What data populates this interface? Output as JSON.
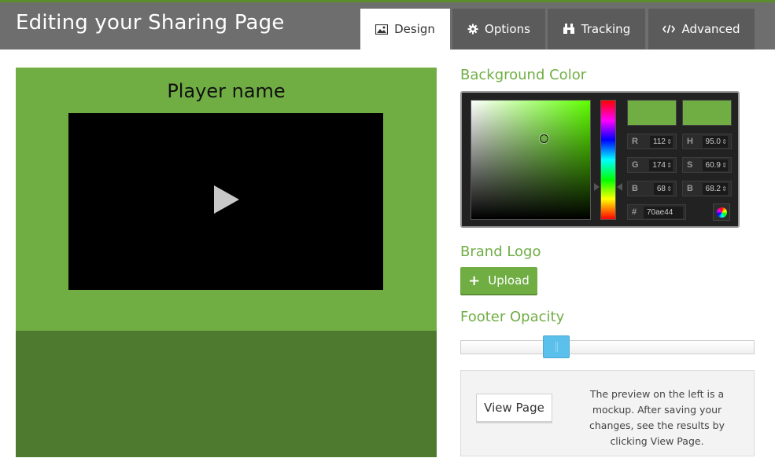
{
  "header": {
    "title": "Editing your Sharing Page",
    "tabs": [
      {
        "label": "Design",
        "icon": "image-icon",
        "active": true
      },
      {
        "label": "Options",
        "icon": "gear-icon",
        "active": false
      },
      {
        "label": "Tracking",
        "icon": "binoculars-icon",
        "active": false
      },
      {
        "label": "Advanced",
        "icon": "code-icon",
        "active": false
      }
    ]
  },
  "preview": {
    "player_name": "Player name",
    "background_color": "#70ae44",
    "footer_color": "#4e7a30"
  },
  "background_color": {
    "title": "Background Color",
    "r_label": "R",
    "r": "112",
    "g_label": "G",
    "g": "174",
    "b_label": "B",
    "b": "68",
    "h_label": "H",
    "h": "95.0",
    "s_label": "S",
    "s": "60.9",
    "v_label": "B",
    "v": "68.2",
    "hex_label": "#",
    "hex": "70ae44"
  },
  "brand_logo": {
    "title": "Brand Logo",
    "upload_label": "Upload"
  },
  "footer_opacity": {
    "title": "Footer Opacity",
    "value": 0.33
  },
  "info": {
    "view_page_label": "View Page",
    "text": "The preview on the left is a mockup. After saving your changes, see the results by clicking View Page."
  },
  "colors": {
    "accent": "#70ae44",
    "header_bg": "#6e6e6e",
    "tab_bg": "#5b5b5b",
    "slider_handle": "#5bc0eb"
  }
}
